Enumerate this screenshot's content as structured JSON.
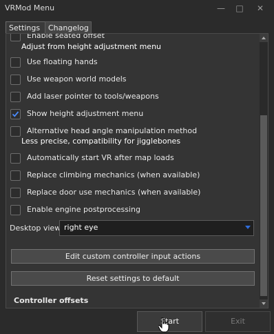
{
  "window": {
    "title": "VRMod Menu",
    "minimize_glyph": "—",
    "maximize_glyph": "□",
    "close_glyph": "✕"
  },
  "tabs": [
    {
      "label": "Settings",
      "active": true
    },
    {
      "label": "Changelog",
      "active": false
    }
  ],
  "settings": {
    "items": [
      {
        "label": "Enable seated offset",
        "checked": false,
        "sub": "Adjust from height adjustment menu"
      },
      {
        "label": "Use floating hands",
        "checked": false
      },
      {
        "label": "Use weapon world models",
        "checked": false
      },
      {
        "label": "Add laser pointer to tools/weapons",
        "checked": false
      },
      {
        "label": "Show height adjustment menu",
        "checked": true
      },
      {
        "label": "Alternative head angle manipulation method",
        "checked": false,
        "sub": "Less precise, compatibility for jigglebones"
      },
      {
        "label": "Automatically start VR after map loads",
        "checked": false
      },
      {
        "label": "Replace climbing mechanics (when available)",
        "checked": false
      },
      {
        "label": "Replace door use mechanics (when available)",
        "checked": false
      },
      {
        "label": "Enable engine postprocessing",
        "checked": false
      }
    ],
    "desktop_view_label": "Desktop view:",
    "desktop_view_value": "right eye",
    "edit_button": "Edit custom controller input actions",
    "reset_button": "Reset settings to default",
    "section_heading": "Controller offsets"
  },
  "footer": {
    "start_label": "Start",
    "exit_label": "Exit"
  },
  "colors": {
    "background": "#2b2b2b",
    "panel": "#343434",
    "check_accent": "#4a8cff",
    "dropdown_arrow": "#2f6ddb"
  }
}
